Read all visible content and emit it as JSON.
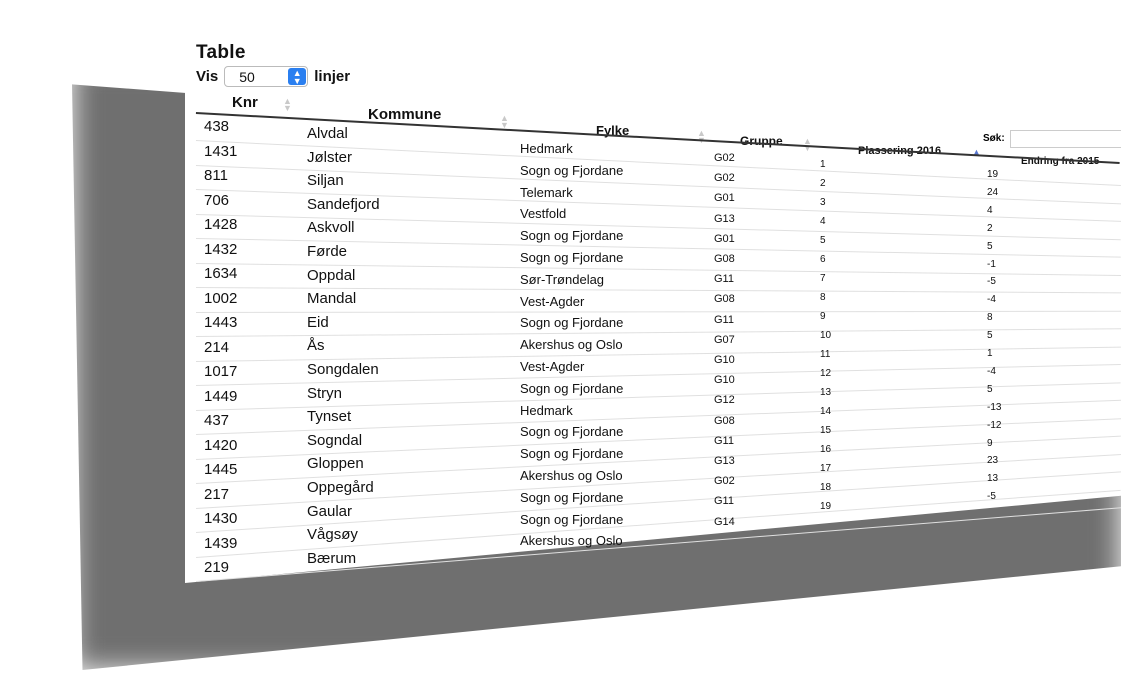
{
  "page": {
    "title": "Table"
  },
  "length_menu": {
    "prefix": "Vis",
    "selected": "50",
    "suffix": "linjer"
  },
  "search": {
    "label": "Søk:",
    "value": ""
  },
  "columns": [
    "Knr",
    "Kommune",
    "Fylke",
    "Gruppe",
    "Plassering 2016",
    "Endring fra 2015"
  ],
  "sorted_column": "Plassering 2016",
  "rows": [
    {
      "knr": "438",
      "kommune": "Alvdal",
      "fylke": "Hedmark",
      "gruppe": "G02",
      "plassering": "1",
      "endring": "19"
    },
    {
      "knr": "1431",
      "kommune": "Jølster",
      "fylke": "Sogn og Fjordane",
      "gruppe": "G02",
      "plassering": "2",
      "endring": "24"
    },
    {
      "knr": "811",
      "kommune": "Siljan",
      "fylke": "Telemark",
      "gruppe": "G01",
      "plassering": "3",
      "endring": "4"
    },
    {
      "knr": "706",
      "kommune": "Sandefjord",
      "fylke": "Vestfold",
      "gruppe": "G13",
      "plassering": "4",
      "endring": "2"
    },
    {
      "knr": "1428",
      "kommune": "Askvoll",
      "fylke": "Sogn og Fjordane",
      "gruppe": "G01",
      "plassering": "5",
      "endring": "5"
    },
    {
      "knr": "1432",
      "kommune": "Førde",
      "fylke": "Sogn og Fjordane",
      "gruppe": "G08",
      "plassering": "6",
      "endring": "-1"
    },
    {
      "knr": "1634",
      "kommune": "Oppdal",
      "fylke": "Sør-Trøndelag",
      "gruppe": "G11",
      "plassering": "7",
      "endring": "-5"
    },
    {
      "knr": "1002",
      "kommune": "Mandal",
      "fylke": "Vest-Agder",
      "gruppe": "G08",
      "plassering": "8",
      "endring": "-4"
    },
    {
      "knr": "1443",
      "kommune": "Eid",
      "fylke": "Sogn og Fjordane",
      "gruppe": "G11",
      "plassering": "9",
      "endring": "8"
    },
    {
      "knr": "214",
      "kommune": "Ås",
      "fylke": "Akershus og Oslo",
      "gruppe": "G07",
      "plassering": "10",
      "endring": "5"
    },
    {
      "knr": "1017",
      "kommune": "Songdalen",
      "fylke": "Vest-Agder",
      "gruppe": "G10",
      "plassering": "11",
      "endring": "1"
    },
    {
      "knr": "1449",
      "kommune": "Stryn",
      "fylke": "Sogn og Fjordane",
      "gruppe": "G10",
      "plassering": "12",
      "endring": "-4"
    },
    {
      "knr": "437",
      "kommune": "Tynset",
      "fylke": "Hedmark",
      "gruppe": "G12",
      "plassering": "13",
      "endring": "5"
    },
    {
      "knr": "1420",
      "kommune": "Sogndal",
      "fylke": "Sogn og Fjordane",
      "gruppe": "G08",
      "plassering": "14",
      "endring": "-13"
    },
    {
      "knr": "1445",
      "kommune": "Gloppen",
      "fylke": "Sogn og Fjordane",
      "gruppe": "G11",
      "plassering": "15",
      "endring": "-12"
    },
    {
      "knr": "217",
      "kommune": "Oppegård",
      "fylke": "Akershus og Oslo",
      "gruppe": "G13",
      "plassering": "16",
      "endring": "9"
    },
    {
      "knr": "1430",
      "kommune": "Gaular",
      "fylke": "Sogn og Fjordane",
      "gruppe": "G02",
      "plassering": "17",
      "endring": "23"
    },
    {
      "knr": "1439",
      "kommune": "Vågsøy",
      "fylke": "Sogn og Fjordane",
      "gruppe": "G11",
      "plassering": "18",
      "endring": "13"
    },
    {
      "knr": "219",
      "kommune": "Bærum",
      "fylke": "Akershus og Oslo",
      "gruppe": "G14",
      "plassering": "19",
      "endring": "-5"
    }
  ]
}
